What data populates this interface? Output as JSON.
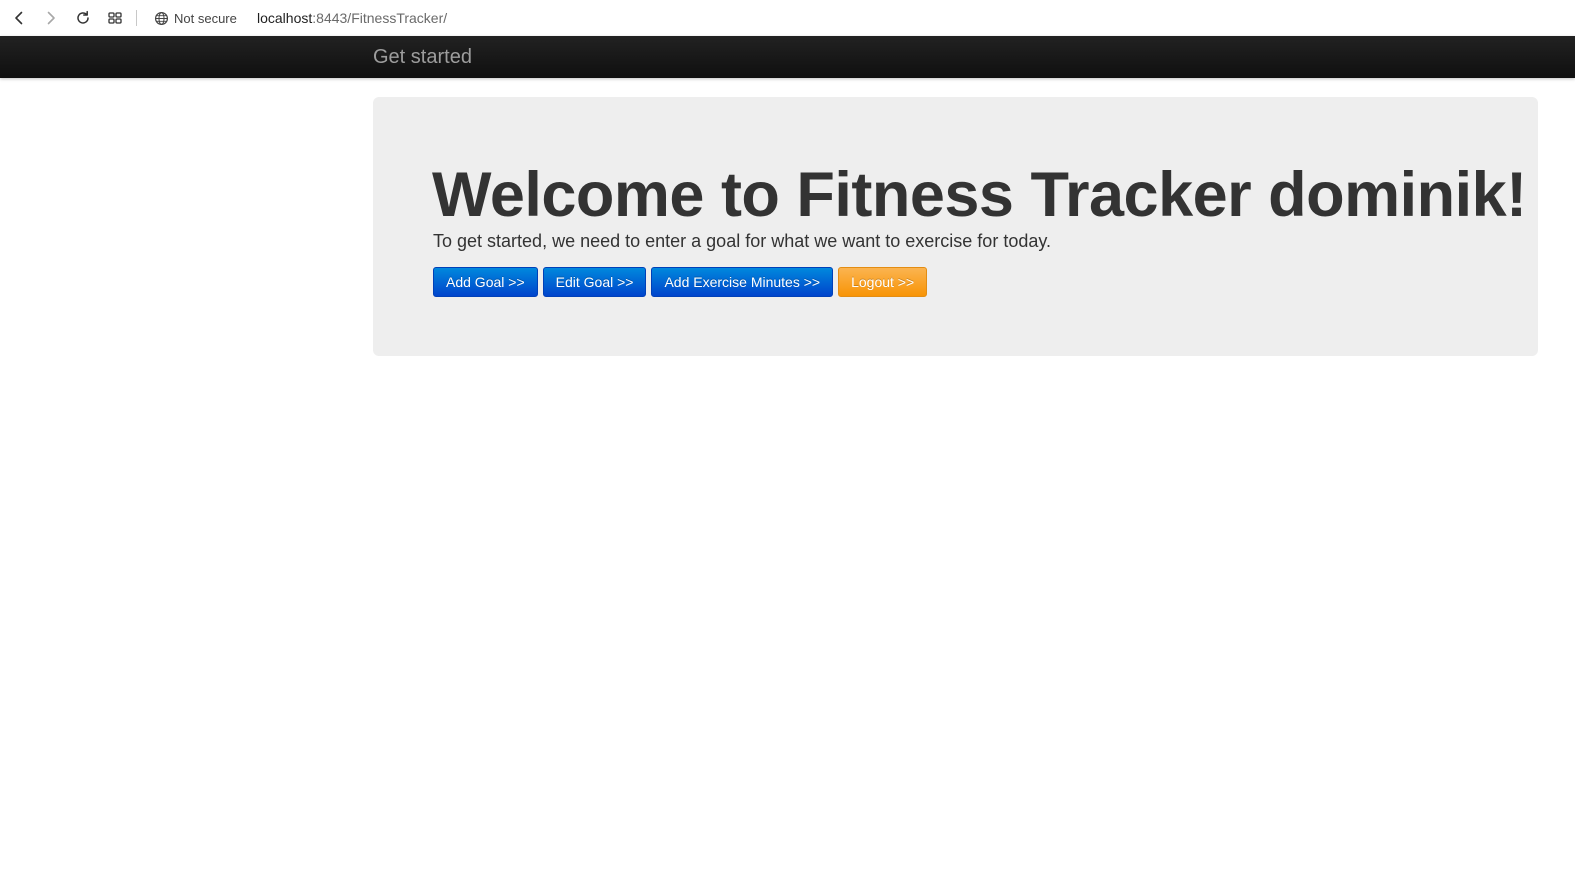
{
  "browser": {
    "security_label": "Not secure",
    "url_host": "localhost",
    "url_rest": ":8443/FitnessTracker/",
    "icons": [
      "back-arrow-icon",
      "forward-arrow-icon",
      "reload-icon",
      "tab-grid-icon",
      "globe-icon"
    ]
  },
  "navbar": {
    "brand": "Get started"
  },
  "jumbotron": {
    "heading": "Welcome to Fitness Tracker dominik!",
    "lead": "To get started, we need to enter a goal for what we want to exercise for today.",
    "buttons": {
      "add_goal": "Add Goal >>",
      "edit_goal": "Edit Goal >>",
      "add_exercise": "Add Exercise Minutes >>",
      "logout": "Logout >>"
    }
  },
  "colors": {
    "navbar_bg": "#1b1b1b",
    "jumbotron_bg": "#eeeeee",
    "primary": "#0055cc",
    "warning": "#f89406"
  }
}
